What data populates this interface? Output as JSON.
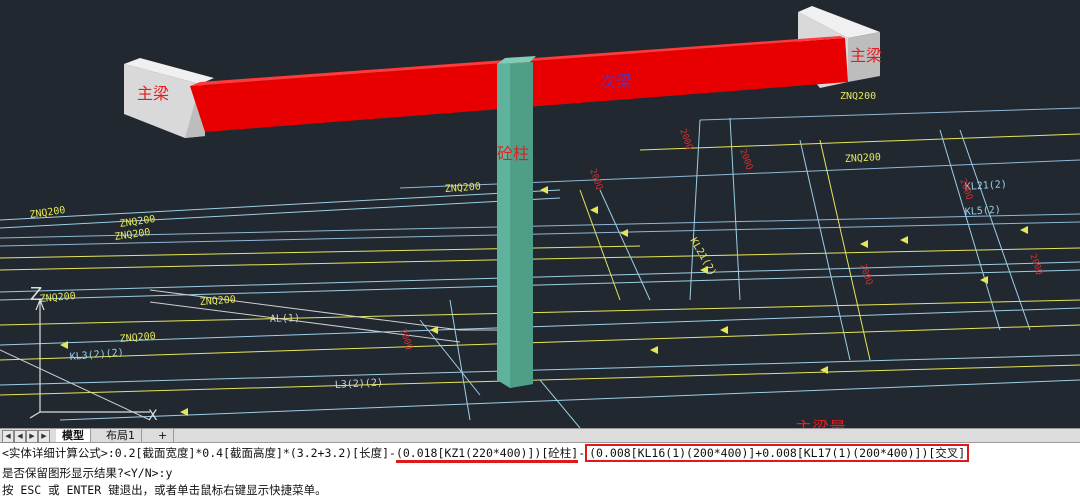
{
  "viewport": {
    "labels": {
      "main_beam_left": "主梁",
      "main_beam_right": "主梁",
      "secondary_beam": "次梁",
      "column": "砼柱",
      "main_beam_qty": "主梁量"
    },
    "axis_z": "Z",
    "drawing_text": [
      "ZNQ200",
      "ZNQ200",
      "ZNQ200",
      "ZNQ200",
      "ZNQ200",
      "ZNQ200",
      "ZNQ200",
      "ZNQ200",
      "KL3(2)(2)",
      "AL(1)",
      "L3(2)(2)",
      "KL21(2)",
      "ZNQ200"
    ]
  },
  "tabbar": {
    "tabs": [
      "模型",
      "布局1",
      "+"
    ],
    "active": 0,
    "nav": [
      "◀",
      "◀",
      "▶",
      "▶"
    ]
  },
  "command": {
    "line1_prefix": "<实体详细计算公式>:0.2[截面宽度]*0.4[截面高度]*(3.2+3.2)[长度]-",
    "line1_column": "(0.018[KZ1(220*400)])[砼柱]",
    "line1_dash": "-",
    "line1_beam": "(0.008[KL16(1)(200*400)]+0.008[KL17(1)(200*400)])[交叉]",
    "line2": "是否保留图形显示结果?<Y/N>:y",
    "line3": "按 ESC 或 ENTER 键退出，或者单击鼠标右键显示快捷菜单。"
  },
  "colors": {
    "background": "#212830",
    "beam": "#e80000",
    "column": "#5fb39c",
    "support": "#dedede",
    "highlight": "#e01818"
  }
}
